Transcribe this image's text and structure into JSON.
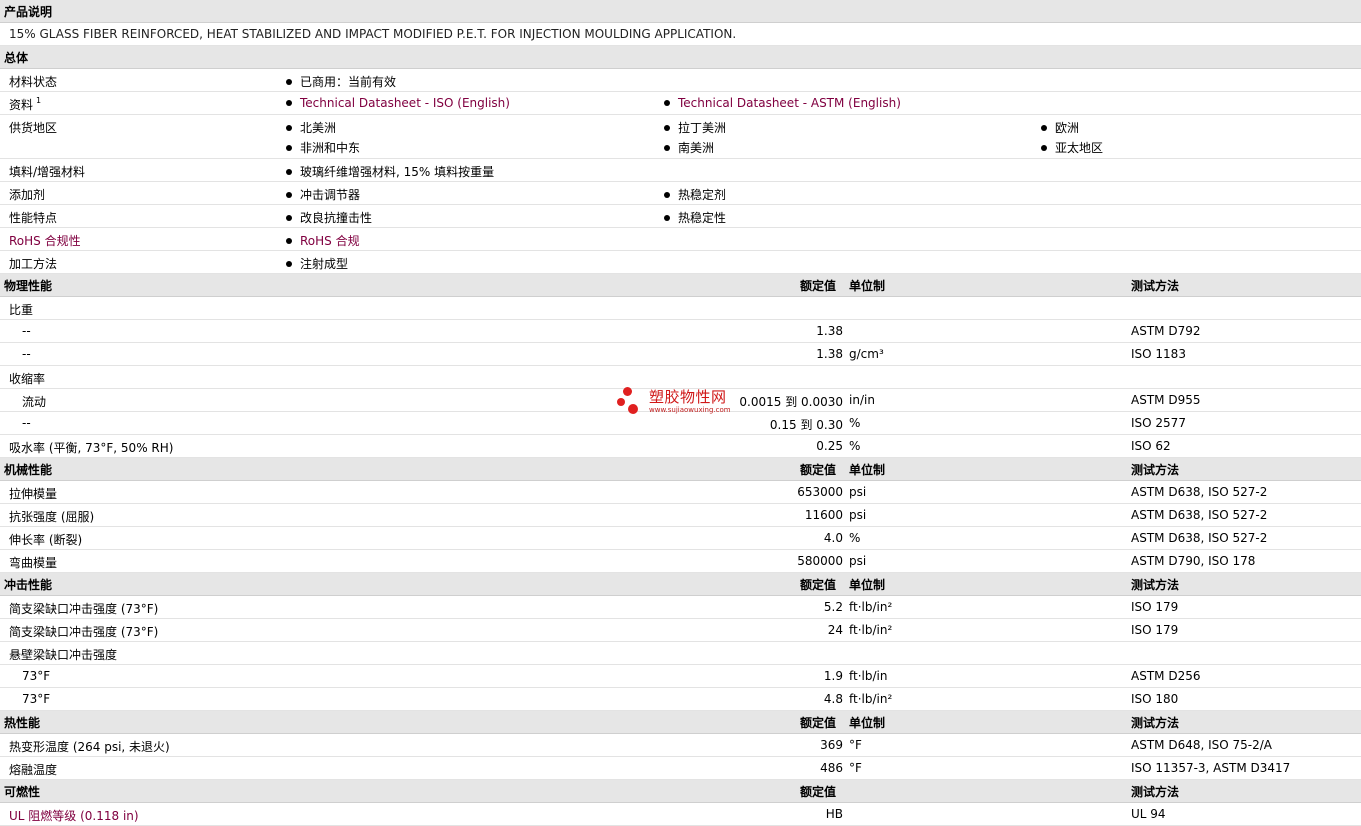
{
  "sections": {
    "desc_title": "产品说明",
    "desc_text": "15% GLASS FIBER REINFORCED, HEAT STABILIZED AND IMPACT MODIFIED P.E.T. FOR INJECTION MOULDING APPLICATION.",
    "general_title": "总体",
    "physical_title": "物理性能",
    "mechanical_title": "机械性能",
    "impact_title": "冲击性能",
    "thermal_title": "热性能",
    "flammability_title": "可燃性"
  },
  "col_headers": {
    "value": "额定值",
    "unit": "单位制",
    "method": "测试方法"
  },
  "general": {
    "status_label": "材料状态",
    "status_value": "已商用：当前有效",
    "docs_label": "资料",
    "docs_sup": "1",
    "doc_iso": "Technical Datasheet - ISO (English)",
    "doc_astm": "Technical Datasheet - ASTM (English)",
    "region_label": "供货地区",
    "regions": [
      "北美洲",
      "拉丁美洲",
      "欧洲",
      "非洲和中东",
      "南美洲",
      "亚太地区"
    ],
    "filler_label": "填料/增强材料",
    "filler_value": "玻璃纤维增强材料, 15% 填料按重量",
    "additive_label": "添加剂",
    "additives": [
      "冲击调节器",
      "热稳定剂"
    ],
    "feature_label": "性能特点",
    "features": [
      "改良抗撞击性",
      "热稳定性"
    ],
    "rohs_label": "RoHS 合规性",
    "rohs_value": "RoHS 合规",
    "process_label": "加工方法",
    "process_value": "注射成型"
  },
  "physical": {
    "sg_label": "比重",
    "sg1": {
      "label": "--",
      "value": "1.38",
      "unit": "",
      "method": "ASTM D792"
    },
    "sg2": {
      "label": "--",
      "value": "1.38",
      "unit": "g/cm³",
      "method": "ISO 1183"
    },
    "shrink_label": "收缩率",
    "sh1": {
      "label": "流动",
      "value": "0.0015 到  0.0030",
      "unit": "in/in",
      "method": "ASTM D955"
    },
    "sh2": {
      "label": "--",
      "value": "0.15 到  0.30",
      "unit": "%",
      "method": "ISO 2577"
    },
    "wa": {
      "label": "吸水率 (平衡, 73°F, 50% RH)",
      "value": "0.25",
      "unit": "%",
      "method": "ISO 62"
    }
  },
  "mechanical": [
    {
      "label": "拉伸模量",
      "value": "653000",
      "unit": "psi",
      "method": "ASTM D638, ISO 527-2"
    },
    {
      "label": "抗张强度 (屈服)",
      "value": "11600",
      "unit": "psi",
      "method": "ASTM D638, ISO 527-2"
    },
    {
      "label": "伸长率 (断裂)",
      "value": "4.0",
      "unit": "%",
      "method": "ASTM D638, ISO 527-2"
    },
    {
      "label": "弯曲模量",
      "value": "580000",
      "unit": "psi",
      "method": "ASTM D790, ISO 178"
    }
  ],
  "impact": {
    "ch1": {
      "label": "简支梁缺口冲击强度 (73°F)",
      "value": "5.2",
      "unit": "ft·lb/in²",
      "method": "ISO 179"
    },
    "ch2": {
      "label": "简支梁缺口冲击强度 (73°F)",
      "value": "24",
      "unit": "ft·lb/in²",
      "method": "ISO 179"
    },
    "izod_label": "悬壁梁缺口冲击强度",
    "iz1": {
      "label": "73°F",
      "value": "1.9",
      "unit": "ft·lb/in",
      "method": "ASTM D256"
    },
    "iz2": {
      "label": "73°F",
      "value": "4.8",
      "unit": "ft·lb/in²",
      "method": "ISO 180"
    }
  },
  "thermal": [
    {
      "label": "热变形温度 (264 psi, 未退火)",
      "value": "369",
      "unit": "°F",
      "method": "ASTM D648, ISO 75-2/A"
    },
    {
      "label": "熔融温度",
      "value": "486",
      "unit": "°F",
      "method": "ISO 11357-3, ASTM D3417"
    }
  ],
  "flammability": {
    "ul": {
      "label": "UL 阻燃等级 (0.118 in)",
      "value": "HB",
      "method": "UL 94"
    }
  },
  "watermark": {
    "title": "塑胶物性网",
    "url": "www.sujiaowuxing.com"
  }
}
